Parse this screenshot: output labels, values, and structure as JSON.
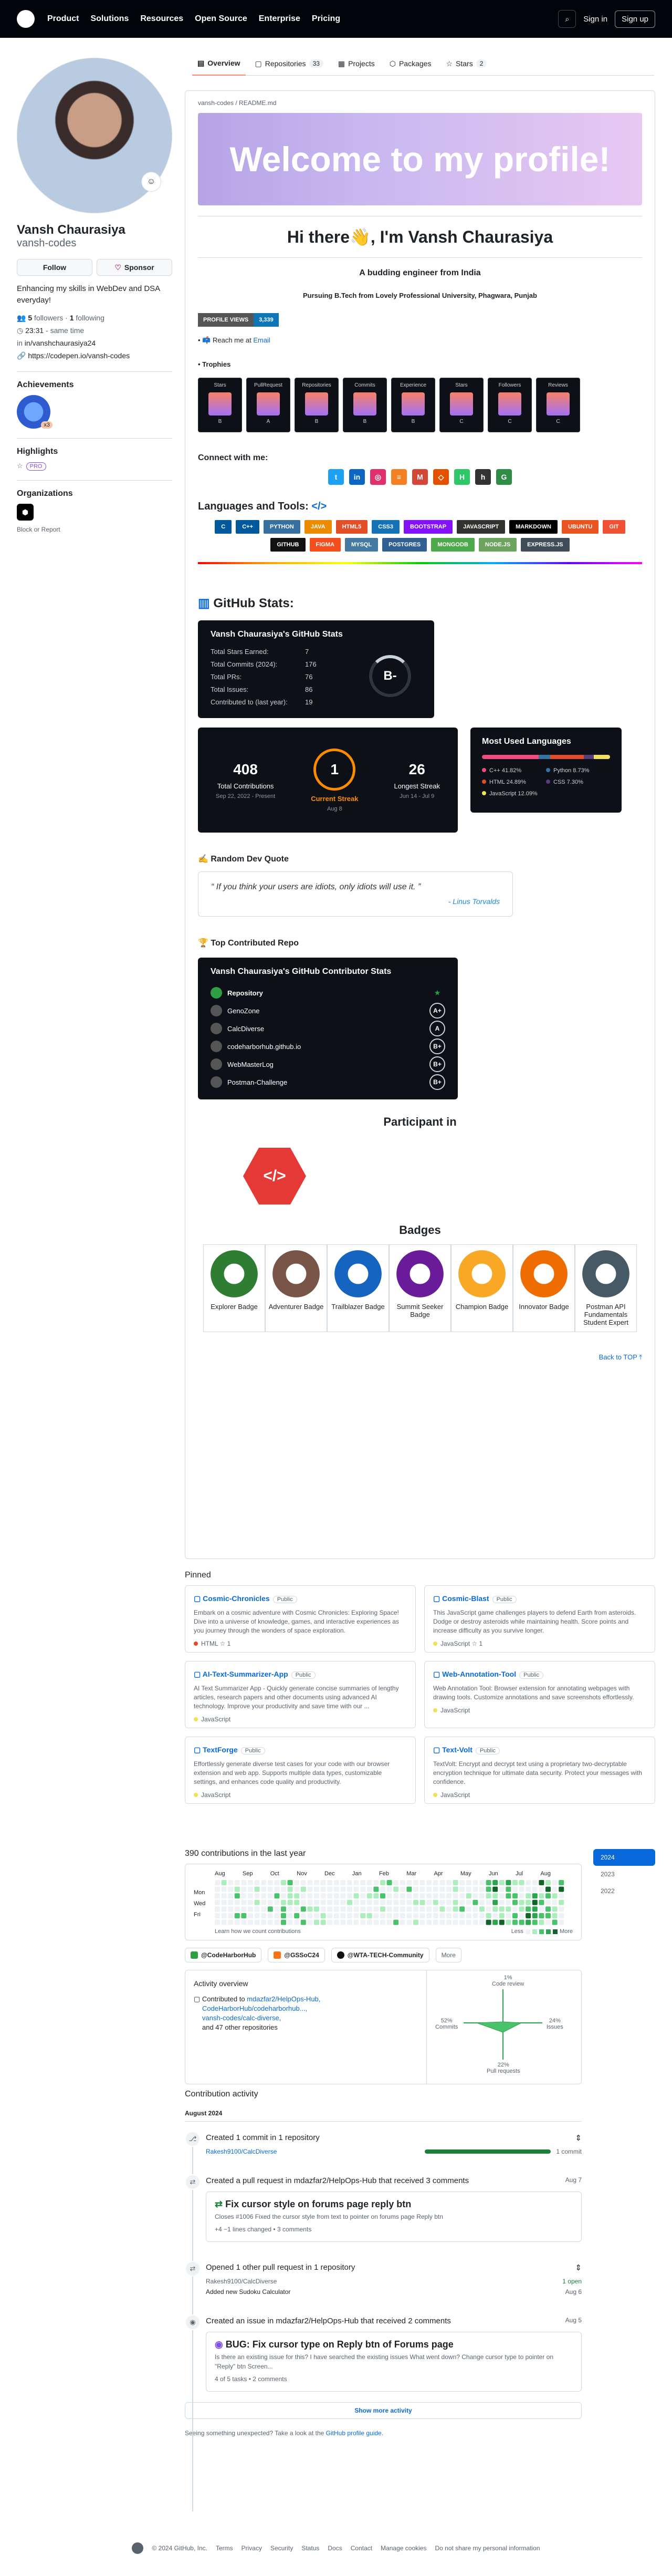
{
  "header": {
    "nav": [
      "Product",
      "Solutions",
      "Resources",
      "Open Source",
      "Enterprise",
      "Pricing"
    ],
    "sign_in": "Sign in",
    "sign_up": "Sign up"
  },
  "tabs": [
    {
      "label": "Overview",
      "count": ""
    },
    {
      "label": "Repositories",
      "count": "33"
    },
    {
      "label": "Projects",
      "count": ""
    },
    {
      "label": "Packages",
      "count": ""
    },
    {
      "label": "Stars",
      "count": "2"
    }
  ],
  "profile": {
    "name": "Vansh Chaurasiya",
    "login": "vansh-codes",
    "follow": "Follow",
    "sponsor": "Sponsor",
    "bio": "Enhancing my skills in WebDev and DSA everyday!",
    "followers": "5",
    "followers_label": "followers",
    "following": "1",
    "following_label": "following",
    "time": "23:31",
    "time_note": "- same time",
    "linkedin": "in/vanshchaurasiya24",
    "codepen": "https://codepen.io/vansh-codes",
    "achievements": "Achievements",
    "ach_count": "x3",
    "highlights": "Highlights",
    "pro": "PRO",
    "organizations": "Organizations",
    "block": "Block or Report"
  },
  "readme": {
    "path": "vansh-codes / README.md",
    "banner": "Welcome to my profile!",
    "greeting": "Hi there👋, I'm Vansh Chaurasiya",
    "subtitle": "A budding engineer from India",
    "education": "Pursuing B.Tech from Lovely Professional University, Phagwara, Punjab",
    "views_label": "PROFILE VIEWS",
    "views": "3,339",
    "reach": "Reach me at",
    "email": "Email",
    "trophies_label": "Trophies",
    "trophies": [
      {
        "name": "Stars",
        "rank": "B"
      },
      {
        "name": "PullRequest",
        "rank": "A"
      },
      {
        "name": "Repositories",
        "rank": "B"
      },
      {
        "name": "Commits",
        "rank": "B"
      },
      {
        "name": "Experience",
        "rank": "B"
      },
      {
        "name": "Stars",
        "rank": "C"
      },
      {
        "name": "Followers",
        "rank": "C"
      },
      {
        "name": "Reviews",
        "rank": "C"
      }
    ],
    "connect": "Connect with me:",
    "tools_title": "Languages and Tools:",
    "tools": [
      {
        "n": "C",
        "c": "#00599c"
      },
      {
        "n": "C++",
        "c": "#00599c"
      },
      {
        "n": "PYTHON",
        "c": "#3670a0"
      },
      {
        "n": "JAVA",
        "c": "#ed8b00"
      },
      {
        "n": "HTML5",
        "c": "#e34f26"
      },
      {
        "n": "CSS3",
        "c": "#1572b6"
      },
      {
        "n": "BOOTSTRAP",
        "c": "#8511fa"
      },
      {
        "n": "JAVASCRIPT",
        "c": "#323330"
      },
      {
        "n": "MARKDOWN",
        "c": "#000000"
      },
      {
        "n": "UBUNTU",
        "c": "#e95420"
      },
      {
        "n": "GIT",
        "c": "#f05033"
      },
      {
        "n": "GITHUB",
        "c": "#121011"
      },
      {
        "n": "FIGMA",
        "c": "#f24e1e"
      },
      {
        "n": "MYSQL",
        "c": "#4479a1"
      },
      {
        "n": "POSTGRES",
        "c": "#316192"
      },
      {
        "n": "MONGODB",
        "c": "#4ea94b"
      },
      {
        "n": "NODE.JS",
        "c": "#6da55f"
      },
      {
        "n": "EXPRESS.JS",
        "c": "#404d59"
      }
    ],
    "stats_title": "GitHub Stats:",
    "stats_card_title": "Vansh Chaurasiya's GitHub Stats",
    "stats": [
      {
        "k": "Total Stars Earned:",
        "v": "7"
      },
      {
        "k": "Total Commits (2024):",
        "v": "176"
      },
      {
        "k": "Total PRs:",
        "v": "76"
      },
      {
        "k": "Total Issues:",
        "v": "86"
      },
      {
        "k": "Contributed to (last year):",
        "v": "19"
      }
    ],
    "grade": "B-",
    "streak": {
      "total": "408",
      "total_label": "Total Contributions",
      "total_range": "Sep 22, 2022 - Present",
      "current": "1",
      "current_label": "Current Streak",
      "current_range": "Aug 8",
      "longest": "26",
      "longest_label": "Longest Streak",
      "longest_range": "Jun 14 - Jul 9"
    },
    "langs_title": "Most Used Languages",
    "langs": [
      {
        "n": "C++",
        "p": "41.82%",
        "c": "#f34b7d",
        "w": 41.82
      },
      {
        "n": "Python",
        "p": "8.73%",
        "c": "#3572a5",
        "w": 8.73
      },
      {
        "n": "HTML",
        "p": "24.89%",
        "c": "#e34c26",
        "w": 24.89
      },
      {
        "n": "CSS",
        "p": "7.30%",
        "c": "#563d7c",
        "w": 7.3
      },
      {
        "n": "JavaScript",
        "p": "12.09%",
        "c": "#f1e05a",
        "w": 12.09
      }
    ],
    "quote_title": "Random Dev Quote",
    "quote": "If you think your users are idiots, only idiots will use it.",
    "quote_author": "- Linus Torvalds",
    "contrib_title": "Top Contributed Repo",
    "contrib_card_title": "Vansh Chaurasiya's GitHub Contributor Stats",
    "repo_header": "Repository",
    "repos": [
      {
        "n": "GenoZone",
        "r": "A+"
      },
      {
        "n": "CalcDiverse",
        "r": "A"
      },
      {
        "n": "codeharborhub.github.io",
        "r": "B+"
      },
      {
        "n": "WebMasterLog",
        "r": "B+"
      },
      {
        "n": "Postman-Challenge",
        "r": "B+"
      }
    ],
    "participant": "Participant in",
    "badges_title": "Badges",
    "badges": [
      {
        "n": "Explorer Badge",
        "c": "#2e7d32"
      },
      {
        "n": "Adventurer Badge",
        "c": "#795548"
      },
      {
        "n": "Trailblazer Badge",
        "c": "#1565c0"
      },
      {
        "n": "Summit Seeker Badge",
        "c": "#6a1b9a"
      },
      {
        "n": "Champion Badge",
        "c": "#f9a825"
      },
      {
        "n": "Innovator Badge",
        "c": "#ef6c00"
      },
      {
        "n": "Postman API Fundamentals Student Expert",
        "c": "#455a64"
      }
    ],
    "back_top": "Back to TOP ⤒"
  },
  "pinned": {
    "title": "Pinned",
    "public": "Public",
    "items": [
      {
        "name": "Cosmic-Chronicles",
        "desc": "Embark on a cosmic adventure with Cosmic Chronicles: Exploring Space! Dive into a universe of knowledge, games, and interactive experiences as you journey through the wonders of space exploration.",
        "lang": "HTML",
        "color": "#e34c26",
        "stars": "1"
      },
      {
        "name": "Cosmic-Blast",
        "desc": "This JavaScript game challenges players to defend Earth from asteroids. Dodge or destroy asteroids while maintaining health. Score points and increase difficulty as you survive longer.",
        "lang": "JavaScript",
        "color": "#f1e05a",
        "stars": "1"
      },
      {
        "name": "AI-Text-Summarizer-App",
        "desc": "AI Text Summarizer App - Quickly generate concise summaries of lengthy articles, research papers and other documents using advanced AI technology. Improve your productivity and save time with our ...",
        "lang": "JavaScript",
        "color": "#f1e05a",
        "stars": ""
      },
      {
        "name": "Web-Annotation-Tool",
        "desc": "Web Annotation Tool: Browser extension for annotating webpages with drawing tools. Customize annotations and save screenshots effortlessly.",
        "lang": "JavaScript",
        "color": "#f1e05a",
        "stars": ""
      },
      {
        "name": "TextForge",
        "desc": "Effortlessly generate diverse test cases for your code with our browser extension and web app. Supports multiple data types, customizable settings, and enhances code quality and productivity.",
        "lang": "JavaScript",
        "color": "#f1e05a",
        "stars": ""
      },
      {
        "name": "Text-Volt",
        "desc": "TextVolt: Encrypt and decrypt text using a proprietary two-decryptable encryption technique for ultimate data security. Protect your messages with confidence.",
        "lang": "JavaScript",
        "color": "#f1e05a",
        "stars": ""
      }
    ]
  },
  "calendar": {
    "title": "390 contributions in the last year",
    "months": [
      "Aug",
      "Sep",
      "Oct",
      "Nov",
      "Dec",
      "Jan",
      "Feb",
      "Mar",
      "Apr",
      "May",
      "Jun",
      "Jul",
      "Aug"
    ],
    "days": [
      "Mon",
      "Wed",
      "Fri"
    ],
    "learn": "Learn how we count contributions",
    "less": "Less",
    "more": "More",
    "years": [
      "2024",
      "2023",
      "2022"
    ]
  },
  "orgs": [
    "@CodeHarborHub",
    "@GSSoC24",
    "@WTA-TECH-Community",
    "More"
  ],
  "overview": {
    "title": "Activity overview",
    "contributed": "Contributed to",
    "r1": "mdazfar2/HelpOps-Hub,",
    "r2": "CodeHarborHub/codeharborhub...,",
    "r3": "vansh-codes/calc-diverse,",
    "other": "and 47 other repositories",
    "code_review": "Code review",
    "commits": "Commits",
    "issues": "Issues",
    "prs": "Pull requests",
    "cr_pct": "1%",
    "c_pct": "52%",
    "i_pct": "24%",
    "pr_pct": "22%"
  },
  "activity": {
    "title": "Contribution activity",
    "month": "August 2024",
    "e1": "Created 1 commit in 1 repository",
    "e1_repo": "Rakesh9100/CalcDiverse",
    "e1_count": "1 commit",
    "e2": "Created a pull request in mdazfar2/HelpOps-Hub that received 3 comments",
    "e2_date": "Aug 7",
    "e2_title_pre": "Fix",
    "e2_title": "Fix cursor style on forums page reply btn",
    "e2_body": "Closes #1006 Fixed the cursor style from text to pointer on forums page Reply btn",
    "e2_meta": "+4 −1 lines changed • 3 comments",
    "e3": "Opened 1 other pull request in 1 repository",
    "e3_repo": "Rakesh9100/CalcDiverse",
    "e3_open": "1 open",
    "e3_item": "Added new Sudoku Calculator",
    "e3_date": "Aug 6",
    "e4": "Created an issue in mdazfar2/HelpOps-Hub that received 2 comments",
    "e4_date": "Aug 5",
    "e4_title": "BUG: Fix cursor type on Reply btn of Forums page",
    "e4_body": "Is there an existing issue for this? I have searched the existing issues What went down? Change cursor type to pointer on \"Reply\" btn  Screen...",
    "e4_meta": "4 of 5 tasks • 2 comments",
    "show_more": "Show more activity",
    "unexpected": "Seeing something unexpected? Take a look at the",
    "guide": "GitHub profile guide"
  },
  "footer": [
    "© 2024 GitHub, Inc.",
    "Terms",
    "Privacy",
    "Security",
    "Status",
    "Docs",
    "Contact",
    "Manage cookies",
    "Do not share my personal information"
  ]
}
